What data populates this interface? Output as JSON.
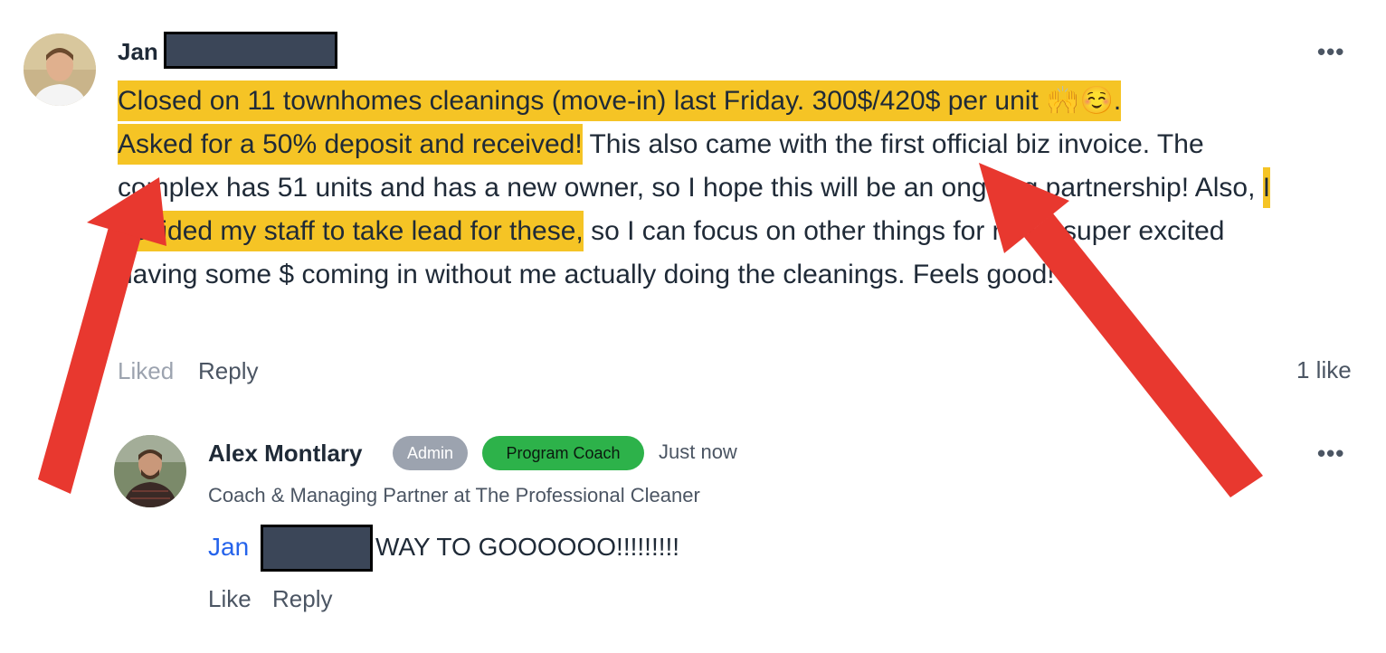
{
  "post": {
    "author_first": "Jan",
    "text_highlight_1": "Closed on 11 townhomes cleanings (move-in) last Friday. 300$/420$ per unit 🙌☺️.",
    "text_highlight_2": "Asked for a 50% deposit and received!",
    "text_plain_1": " This also came with the first official biz invoice. The complex has 51 units and has a new owner, so I hope this will be an ongoing partnership! Also, ",
    "text_highlight_3": "I decided my staff to take lead for these,",
    "text_plain_2": " so I can focus on other things for now...super excited having some $ coming in without me actually doing the cleanings. Feels good!",
    "liked_label": "Liked",
    "reply_label": "Reply",
    "like_count": "1 like",
    "more_icon": "more-horizontal-icon"
  },
  "reply": {
    "author": "Alex Montlary",
    "badge_admin": "Admin",
    "badge_coach": "Program Coach",
    "time": "Just now",
    "subtitle": "Coach & Managing Partner at The Professional Cleaner",
    "mention": "Jan",
    "text": "WAY TO GOOOOOO!!!!!!!!!",
    "like_label": "Like",
    "reply_label": "Reply",
    "more_icon": "more-horizontal-icon"
  },
  "colors": {
    "highlight": "#f5c425",
    "arrow": "#e8382f",
    "coach_badge": "#2db24a",
    "admin_badge": "#9ca3af",
    "mention": "#2563eb"
  }
}
